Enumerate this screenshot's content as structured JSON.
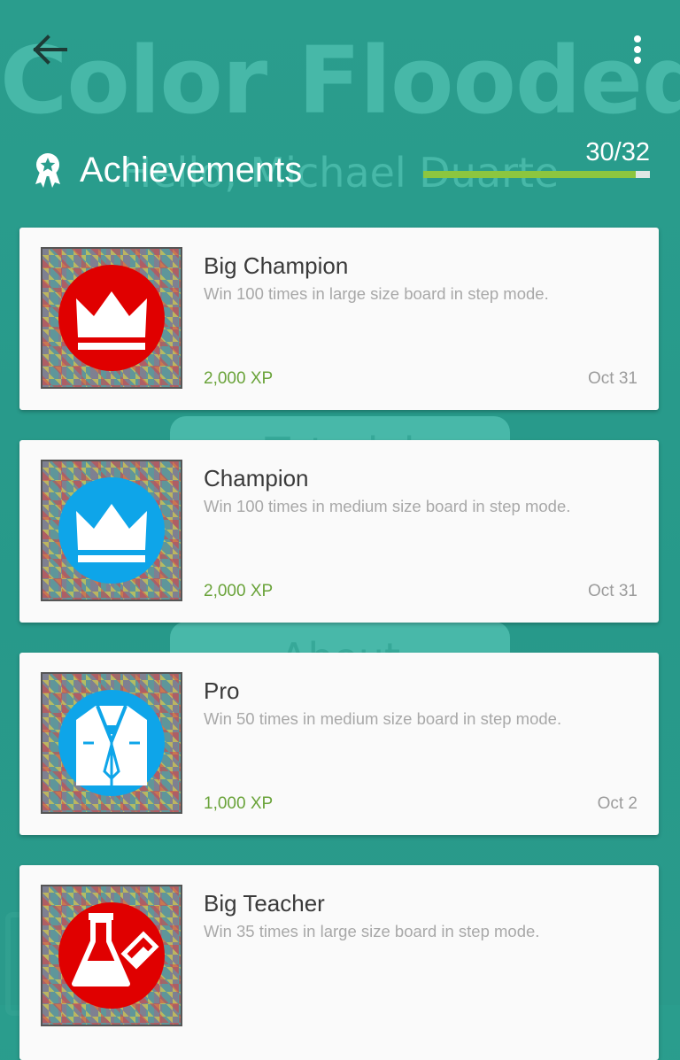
{
  "background": {
    "title": "Color Flooded",
    "greeting": "Hello, Michael Duarte",
    "button1": "Tutorial",
    "button2": "About"
  },
  "header": {
    "title": "Achievements",
    "count": "30/32",
    "progress": 0.9375
  },
  "colors": {
    "accent_green": "#8cc63f",
    "xp_green": "#6aa33a",
    "teal_bg": "#2a9d8d",
    "badge_red": "#e00000",
    "badge_blue": "#0ea5e9"
  },
  "achievements": [
    {
      "title": "Big Champion",
      "description": "Win 100 times in large size board in step mode.",
      "xp": "2,000 XP",
      "date": "Oct 31",
      "icon": "crown-icon",
      "badge_color": "#e00000"
    },
    {
      "title": "Champion",
      "description": "Win 100 times in medium size board in step mode.",
      "xp": "2,000 XP",
      "date": "Oct 31",
      "icon": "crown-icon",
      "badge_color": "#0ea5e9"
    },
    {
      "title": "Pro",
      "description": "Win 50 times in medium size board in step mode.",
      "xp": "1,000 XP",
      "date": "Oct 2",
      "icon": "suit-icon",
      "badge_color": "#0ea5e9"
    },
    {
      "title": "Big Teacher",
      "description": "Win 35 times in large size board in step mode.",
      "xp": "",
      "date": "",
      "icon": "flask-icon",
      "badge_color": "#e00000"
    }
  ]
}
